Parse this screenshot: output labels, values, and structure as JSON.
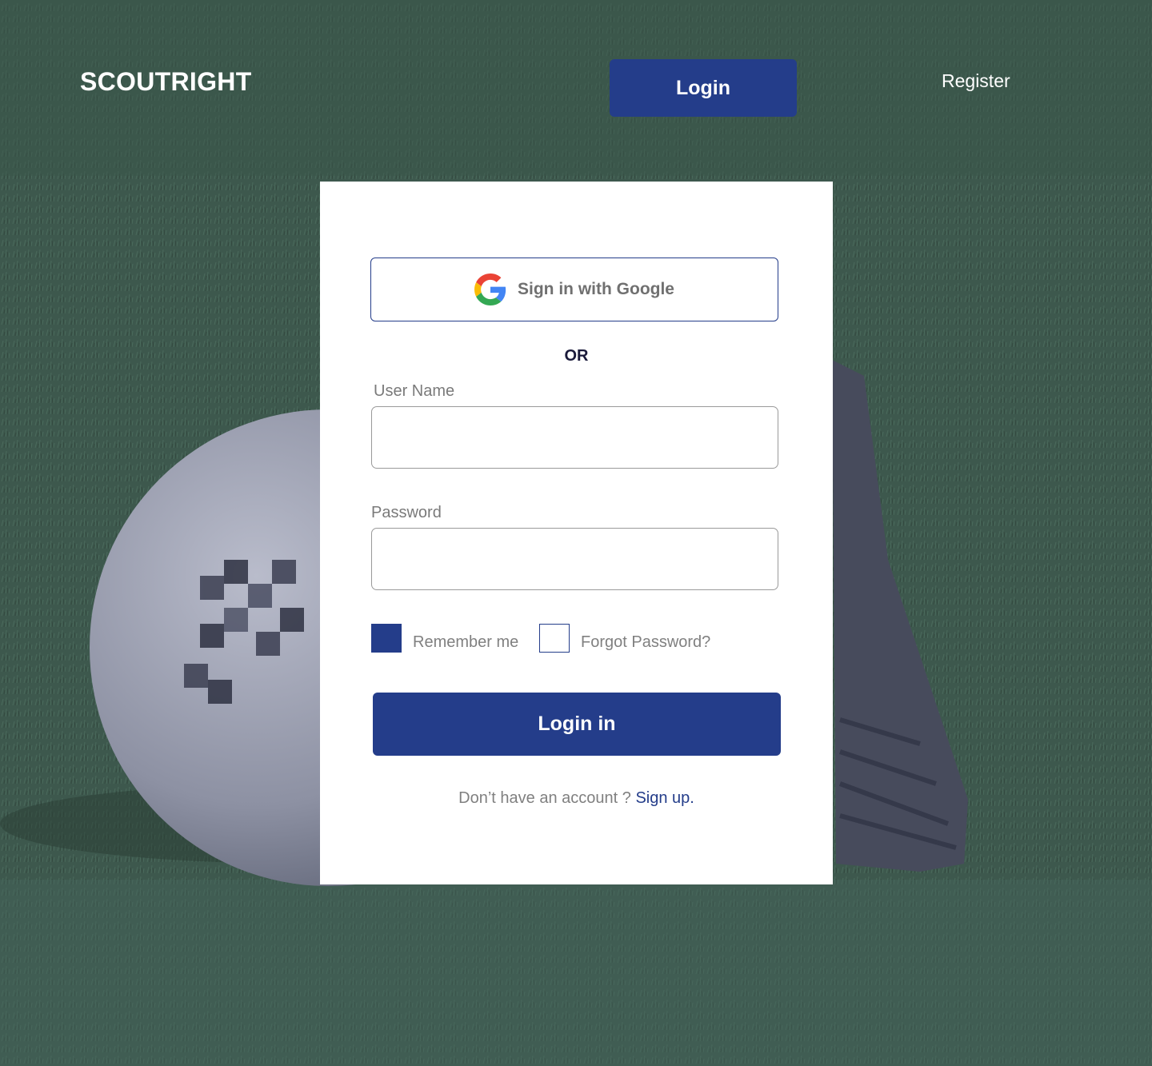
{
  "header": {
    "brand": "SCOUTRIGHT",
    "login_label": "Login",
    "register_label": "Register"
  },
  "login_card": {
    "google_label": "Sign in with Google",
    "or_label": "OR",
    "username": {
      "label": "User Name",
      "value": "",
      "placeholder": ""
    },
    "password": {
      "label": "Password",
      "value": "",
      "placeholder": ""
    },
    "remember_label": "Remember me",
    "remember_checked": true,
    "forgot_label": "Forgot Password?",
    "submit_label": "Login in",
    "no_account_text": "Don’t have an account ? ",
    "signup_label": "Sign up."
  },
  "icons": {
    "google": "google-g-icon"
  },
  "colors": {
    "accent": "#243d8a",
    "turf": "#3e5a4f",
    "card": "#ffffff",
    "muted_text": "#7a7a7a"
  }
}
